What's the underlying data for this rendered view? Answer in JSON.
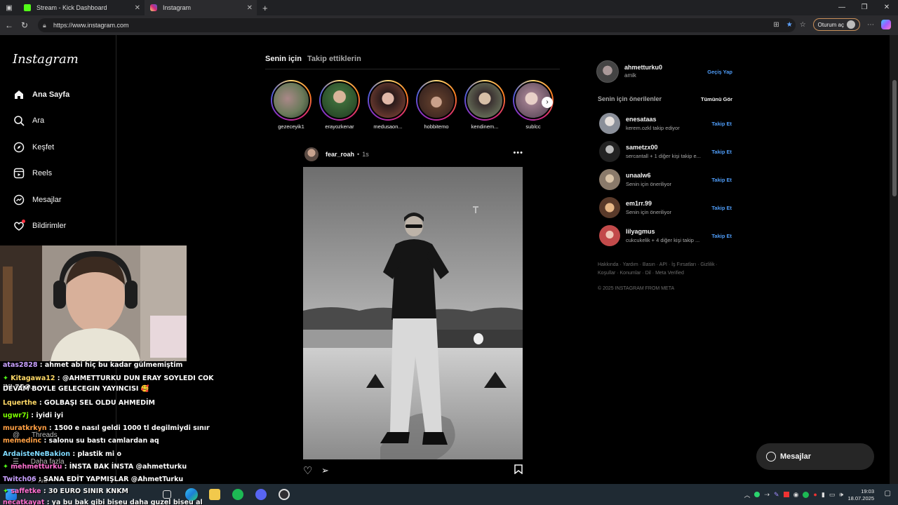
{
  "browser": {
    "tabs": [
      {
        "label": "Stream - Kick Dashboard",
        "icon": "kick-icon",
        "color": "#53fc18"
      },
      {
        "label": "Instagram",
        "icon": "instagram-icon",
        "color": "#e1306c"
      }
    ],
    "url": "https://www.instagram.com",
    "signin_label": "Oturum aç"
  },
  "sidebar": {
    "logo": "Instagram",
    "items": [
      {
        "label": "Ana Sayfa",
        "icon": "home-icon"
      },
      {
        "label": "Ara",
        "icon": "search-icon"
      },
      {
        "label": "Keşfet",
        "icon": "compass-icon"
      },
      {
        "label": "Reels",
        "icon": "reels-icon"
      },
      {
        "label": "Mesajlar",
        "icon": "messenger-icon"
      },
      {
        "label": "Bildirimler",
        "icon": "heart-icon"
      },
      {
        "label": "Threads",
        "icon": "threads-icon"
      },
      {
        "label": "Daha fazla",
        "icon": "menu-icon"
      },
      {
        "label": "Ara",
        "icon": "search-icon"
      }
    ]
  },
  "feed": {
    "tab_for_you": "Senin için",
    "tab_following": "Takip ettiklerin",
    "stories": [
      {
        "name": "gezeceyik1",
        "color": "#6a7a5a"
      },
      {
        "name": "erayozkenar",
        "color": "#3d6b3a"
      },
      {
        "name": "medusaon...",
        "color": "#8a4a3a"
      },
      {
        "name": "hobbitemo",
        "color": "#5a3a2a"
      },
      {
        "name": "kendinem...",
        "color": "#7a8a6a"
      },
      {
        "name": "sublcc",
        "color": "#9a7a8a"
      }
    ],
    "post": {
      "username": "fear_roah",
      "separator": "•",
      "time": "1s",
      "more": "•••"
    }
  },
  "right": {
    "user": {
      "username": "ahmetturku0",
      "name": "amik",
      "switch": "Geçiş Yap"
    },
    "suggestions_title": "Senin için önerilenler",
    "see_all": "Tümünü Gör",
    "follow_label": "Takip Et",
    "suggestions": [
      {
        "username": "enesataas",
        "sub": "kerem.ozkl takip ediyor",
        "color": "#8a8f99"
      },
      {
        "username": "sametzx00",
        "sub": "sercantall + 1 diğer kişi takip e...",
        "color": "#333"
      },
      {
        "username": "unaalw6",
        "sub": "Senin için öneriliyor",
        "color": "#8a7a6a"
      },
      {
        "username": "em1rr.99",
        "sub": "Senin için öneriliyor",
        "color": "#c98a5a"
      },
      {
        "username": "lilyagmus",
        "sub": "cukcukelik + 4 diğer kişi takip ...",
        "color": "#c24a4a"
      }
    ],
    "footer_links": "Hakkında · Yardım · Basın · API · İş Fırsatları · Gizlilik · Koşullar · Konumlar · Dil · Meta Verified",
    "copyright": "© 2025 INSTAGRAM FROM META"
  },
  "messages_pill": "Mesajlar",
  "chat": [
    {
      "user": "atas2828",
      "text": ": ahmet abi hiç bu kadar gülmemiştim",
      "color": "#c9a0ff"
    },
    {
      "user": "Kitagawa12",
      "text": ": @AHMETTURKU DUN ERAY SOYLEDI COK IYI PRO.",
      "color": "#ffd966",
      "badge": true
    },
    {
      "user": "",
      "text": "DEVAM BOYLE GELECEGIN YAYINCISI 🥰",
      "color": "#fff"
    },
    {
      "user": "Lquerthe",
      "text": ": GOLBAŞI SEL OLDU AHMEDİM",
      "color": "#ffd966"
    },
    {
      "user": "ugwr7j",
      "text": ": iyidi iyi",
      "color": "#7cfc00"
    },
    {
      "user": "muratkrkyn",
      "text": ": 1500 e nasıl geldi 1000 tl degilmiydi sınır",
      "color": "#ff9f43"
    },
    {
      "user": "memedinc",
      "text": ": salonu su bastı camlardan aq",
      "color": "#ff9f43"
    },
    {
      "user": "ArdaisteNeBakion",
      "text": ": plastik mi o",
      "color": "#7fdbff"
    },
    {
      "user": "mehmetturku",
      "text": ": İNSTA BAK İNSTA @ahmetturku",
      "color": "#ff6fcf",
      "badge": true
    },
    {
      "user": "Twitch06",
      "text": ": SANA EDİT YAPMIŞLAR @AhmetTurku",
      "color": "#c9a0ff"
    },
    {
      "user": "saffetke",
      "text": ": 30 EURO SINIR KNKM",
      "color": "#ff6fcf",
      "badge": true
    },
    {
      "user": "necatkayat",
      "text": ": ya bu bak gibi biseu daha guzel biseu al",
      "color": "#ff6fcf"
    }
  ],
  "taskbar": {
    "time": "19:03",
    "date": "18.07.2025"
  }
}
